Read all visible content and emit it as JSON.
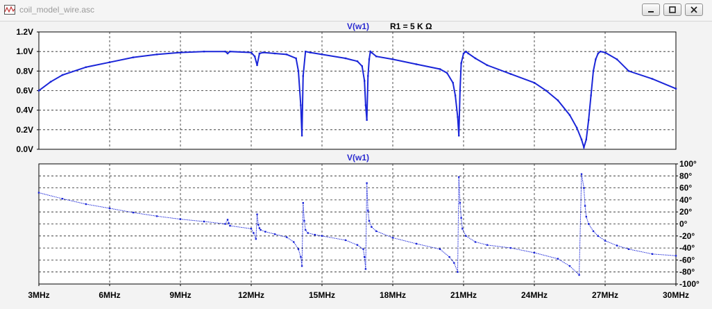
{
  "window": {
    "title": "coil_model_wire.asc"
  },
  "colors": {
    "trace": "#1a25d8",
    "title": "#2a2ad0",
    "grid": "#222222",
    "axis_text": "#000000",
    "background": "#ffffff"
  },
  "icons": {
    "app": "ltspice-waveform-icon",
    "minimize": "minimize-icon",
    "maximize": "maximize-icon",
    "close": "close-icon"
  },
  "chart_data": [
    {
      "type": "line",
      "title": "V(w1)",
      "annotation": "R1 = 5 K Ω",
      "xlim": [
        3,
        30
      ],
      "ylim": [
        0,
        1.2
      ],
      "x_ticks": [
        3,
        6,
        9,
        12,
        15,
        18,
        21,
        24,
        27,
        30
      ],
      "y_ticks": [
        0,
        0.2,
        0.4,
        0.6,
        0.8,
        1.0,
        1.2
      ],
      "y_tick_labels": [
        "0.0V",
        "0.2V",
        "0.4V",
        "0.6V",
        "0.8V",
        "1.0V",
        "1.2V"
      ],
      "grid": true,
      "series": [
        {
          "x": [
            3,
            3.5,
            4,
            5,
            6,
            7,
            8,
            9,
            10,
            10.9,
            11.0,
            11.1,
            12.0,
            12.15,
            12.25,
            12.35,
            12.5,
            13.0,
            13.5,
            13.9,
            14.0,
            14.1,
            14.15,
            14.2,
            14.3,
            14.5,
            15,
            16,
            16.5,
            16.7,
            16.8,
            16.85,
            16.9,
            16.95,
            17.0,
            17.05,
            17.1,
            17.3,
            18,
            19,
            20,
            20.3,
            20.55,
            20.65,
            20.75,
            20.8,
            20.85,
            20.9,
            21.0,
            21.1,
            21.2,
            21.5,
            22,
            23,
            24,
            24.5,
            25,
            25.5,
            25.8,
            26.0,
            26.1,
            26.2,
            26.3,
            26.4,
            26.5,
            26.6,
            26.7,
            26.8,
            27.0,
            27.5,
            28,
            29,
            30
          ],
          "y": [
            0.6,
            0.69,
            0.76,
            0.84,
            0.89,
            0.94,
            0.97,
            0.99,
            1.0,
            1.0,
            0.98,
            1.0,
            0.99,
            0.95,
            0.86,
            0.98,
            0.99,
            0.98,
            0.97,
            0.93,
            0.8,
            0.45,
            0.14,
            0.75,
            1.0,
            0.99,
            0.97,
            0.93,
            0.9,
            0.85,
            0.7,
            0.45,
            0.3,
            0.75,
            0.92,
            1.0,
            0.99,
            0.95,
            0.92,
            0.87,
            0.82,
            0.78,
            0.68,
            0.55,
            0.33,
            0.14,
            0.6,
            0.88,
            0.98,
            1.0,
            0.98,
            0.93,
            0.86,
            0.77,
            0.68,
            0.6,
            0.5,
            0.35,
            0.22,
            0.1,
            0.02,
            0.1,
            0.3,
            0.55,
            0.8,
            0.92,
            0.98,
            1.0,
            0.99,
            0.92,
            0.8,
            0.72,
            0.62
          ]
        }
      ]
    },
    {
      "type": "line",
      "title": "V(w1)",
      "xlim": [
        3,
        30
      ],
      "ylim": [
        -100,
        100
      ],
      "x_ticks": [
        3,
        6,
        9,
        12,
        15,
        18,
        21,
        24,
        27,
        30
      ],
      "x_tick_labels": [
        "3MHz",
        "6MHz",
        "9MHz",
        "12MHz",
        "15MHz",
        "18MHz",
        "21MHz",
        "24MHz",
        "27MHz",
        "30MHz"
      ],
      "y_ticks": [
        -100,
        -80,
        -60,
        -40,
        -20,
        0,
        20,
        40,
        60,
        80,
        100
      ],
      "y_tick_labels": [
        "-100°",
        "-80°",
        "-60°",
        "-40°",
        "-20°",
        "0°",
        "20°",
        "40°",
        "60°",
        "80°",
        "100°"
      ],
      "y_axis_side": "right",
      "grid": true,
      "series": [
        {
          "x": [
            3,
            4,
            5,
            6,
            7,
            8,
            9,
            10,
            10.9,
            11.0,
            11.05,
            11.1,
            12.0,
            12.1,
            12.2,
            12.25,
            12.3,
            12.35,
            12.4,
            12.6,
            13,
            13.5,
            13.8,
            14.0,
            14.1,
            14.15,
            14.2,
            14.25,
            14.3,
            14.4,
            14.7,
            15,
            16,
            16.5,
            16.75,
            16.8,
            16.85,
            16.9,
            16.95,
            17.0,
            17.1,
            17.3,
            18,
            19,
            20,
            20.4,
            20.6,
            20.75,
            20.8,
            20.85,
            20.9,
            20.95,
            21.1,
            21.5,
            22,
            23,
            24,
            25,
            25.5,
            25.9,
            26.0,
            26.1,
            26.15,
            26.2,
            26.3,
            26.5,
            26.7,
            27.0,
            27.5,
            28,
            29,
            30
          ],
          "y": [
            52,
            42,
            33,
            26,
            19,
            13,
            8,
            4,
            0,
            7,
            1,
            -3,
            -8,
            -15,
            -25,
            16,
            -1,
            -7,
            -10,
            -13,
            -17,
            -22,
            -30,
            -42,
            -55,
            -70,
            35,
            5,
            -10,
            -15,
            -18,
            -20,
            -27,
            -35,
            -42,
            -55,
            -75,
            68,
            22,
            5,
            -5,
            -12,
            -23,
            -33,
            -42,
            -55,
            -65,
            -80,
            78,
            35,
            10,
            -8,
            -20,
            -30,
            -35,
            -40,
            -48,
            -58,
            -70,
            -85,
            83,
            60,
            30,
            12,
            0,
            -12,
            -20,
            -28,
            -36,
            -42,
            -50,
            -53
          ]
        }
      ]
    }
  ]
}
